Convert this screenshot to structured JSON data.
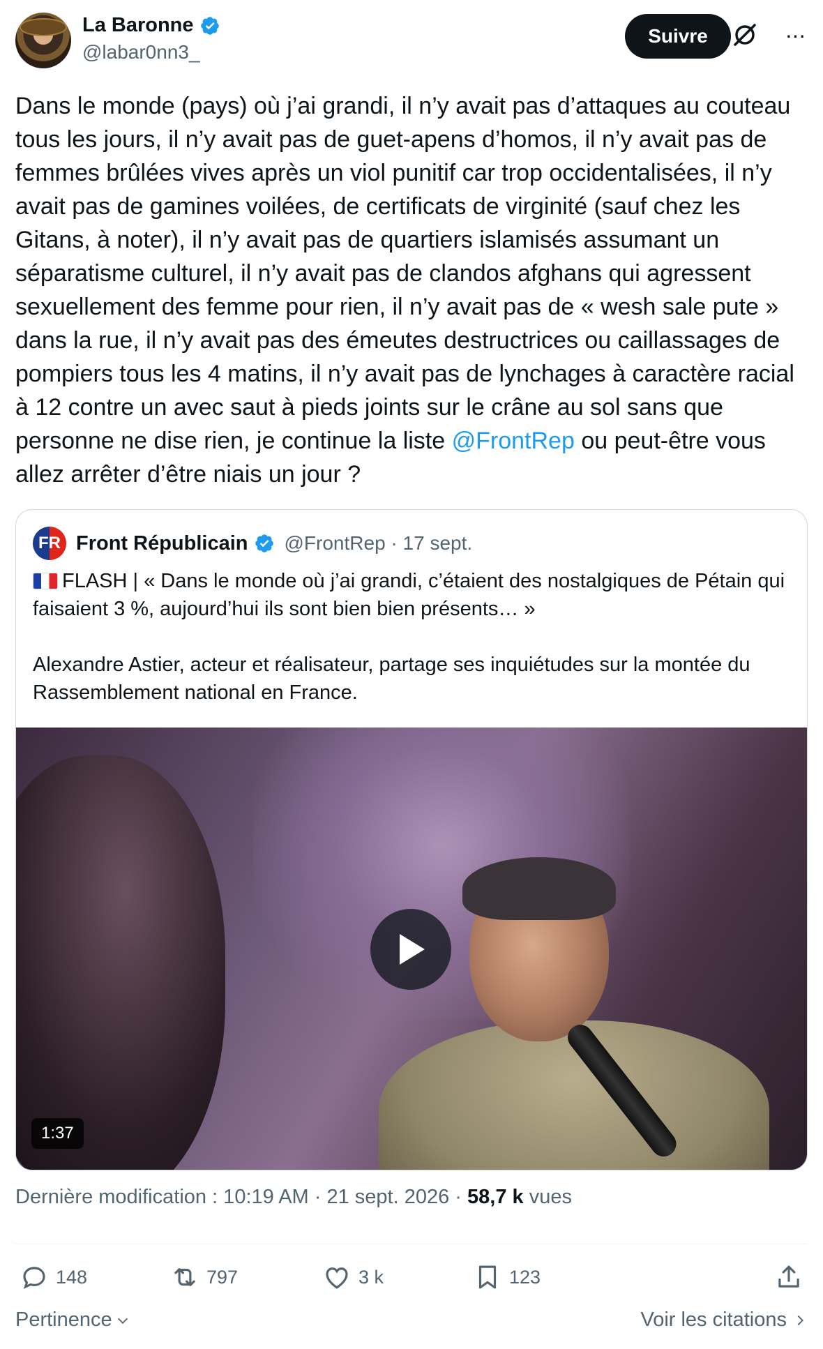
{
  "author": {
    "display_name": "La Baronne",
    "handle": "@labar0nn3_"
  },
  "follow_label": "Suivre",
  "post": {
    "text_before_mention": "Dans le monde (pays) où j’ai grandi, il n’y avait pas d’attaques au couteau tous les jours, il n’y avait pas de guet-apens d’homos, il n’y avait pas de femmes brûlées vives après un viol punitif car trop occidentalisées, il n’y avait pas de gamines voilées, de certificats de virginité (sauf chez les Gitans, à noter), il n’y avait pas de quartiers islamisés assumant un séparatisme culturel, il n’y avait pas de clandos afghans qui agressent sexuellement des femme pour rien, il n’y avait pas de « wesh sale pute » dans la rue, il n’y avait pas des émeutes destructrices ou caillassages de pompiers tous les 4 matins, il n’y avait pas de lynchages à caractère racial à 12 contre un avec saut à pieds joints sur le crâne au sol sans que personne ne dise rien, je continue la liste ",
    "mention": "@FrontRep",
    "text_after_mention": " ou peut-être vous allez arrêter d’être niais un jour ?"
  },
  "quote": {
    "avatar_text": "FR",
    "name": "Front Républicain",
    "handle_date": "@FrontRep · 17 sept.",
    "paragraph1": "FLASH | « Dans le monde où j’ai grandi, c’étaient des nostalgiques de Pétain qui faisaient 3 %, aujourd’hui ils sont bien bien présents… »",
    "paragraph2": "Alexandre Astier, acteur et réalisateur, partage ses inquiétudes sur  la montée du Rassemblement national en France.",
    "video_duration": "1:37"
  },
  "meta": {
    "prefix": "Dernière modification : 10:19 AM · 21 sept. 2026 · ",
    "views_count": "58,7 k",
    "views_label": " vues"
  },
  "actions": {
    "replies": "148",
    "reposts": "797",
    "likes": "3 k",
    "bookmarks": "123"
  },
  "footer": {
    "sort_label": "Pertinence",
    "quotes_link": "Voir les citations"
  },
  "colors": {
    "accent": "#1d9bf0",
    "text": "#0f1419",
    "muted": "#536471",
    "follow_bg": "#0f1419"
  }
}
